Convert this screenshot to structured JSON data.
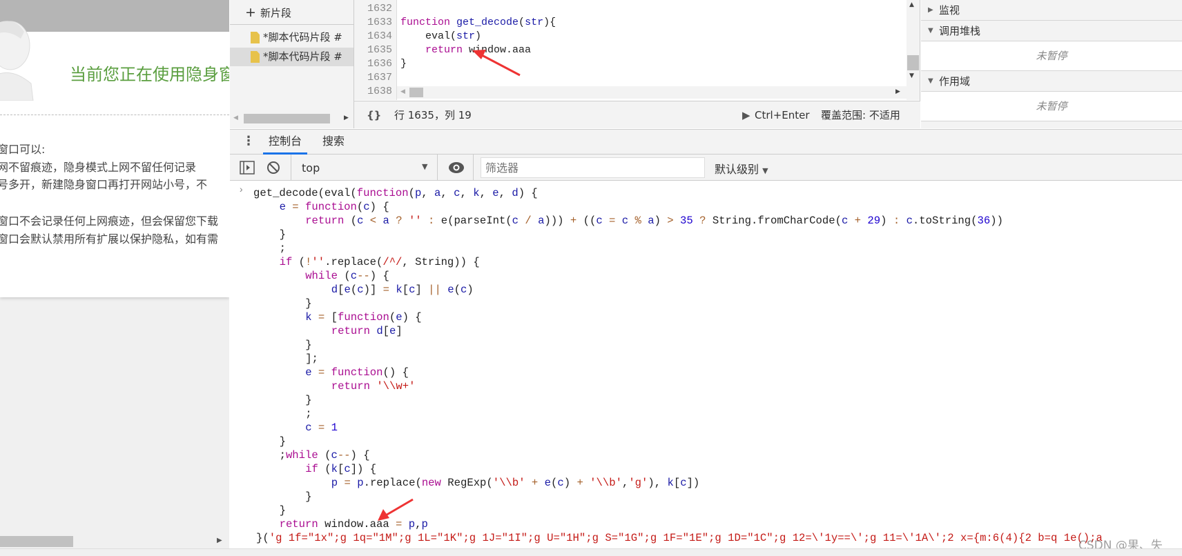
{
  "page": {
    "title": "当前您正在使用隐身窗",
    "lines": [
      "窗口可以:",
      "网不留痕迹，隐身模式上网不留任何记录",
      "号多开，新建隐身窗口再打开网站小号，不",
      "窗口不会记录任何上网痕迹，但会保留您下载",
      "窗口会默认禁用所有扩展以保护隐私，如有需"
    ]
  },
  "snippets": {
    "new_label": "新片段",
    "items": [
      {
        "label": "*脚本代码片段 #"
      },
      {
        "label": "*脚本代码片段 #",
        "selected": true
      }
    ]
  },
  "editor": {
    "lines": [
      {
        "num": "1632",
        "tokens": []
      },
      {
        "num": "1633",
        "tokens": [
          [
            "k",
            "function"
          ],
          [
            "t",
            " "
          ],
          [
            "v",
            "get_decode"
          ],
          [
            "t",
            "("
          ],
          [
            "v",
            "str"
          ],
          [
            "t",
            "){"
          ]
        ]
      },
      {
        "num": "1634",
        "tokens": [
          [
            "t",
            "    eval("
          ],
          [
            "v",
            "str"
          ],
          [
            "t",
            ")"
          ]
        ]
      },
      {
        "num": "1635",
        "tokens": [
          [
            "t",
            "    "
          ],
          [
            "k",
            "return"
          ],
          [
            "t",
            " window.aaa"
          ]
        ]
      },
      {
        "num": "1636",
        "tokens": [
          [
            "t",
            "}"
          ]
        ]
      },
      {
        "num": "1637",
        "tokens": []
      },
      {
        "num": "1638",
        "tokens": []
      }
    ],
    "status": {
      "format_icon": "{}",
      "position": "行 1635，列 19",
      "run_label": "Ctrl+Enter",
      "coverage": "覆盖范围: 不适用"
    }
  },
  "sidebar": {
    "sections": [
      {
        "label": "监视",
        "expanded": false
      },
      {
        "label": "调用堆栈",
        "expanded": true,
        "body": "未暂停"
      },
      {
        "label": "作用域",
        "expanded": true,
        "body": "未暂停"
      }
    ]
  },
  "console": {
    "tabs": [
      {
        "label": "控制台",
        "active": true
      },
      {
        "label": "搜索"
      }
    ],
    "context": "top",
    "filter_placeholder": "筛选器",
    "level": "默认级别",
    "lines": [
      {
        "i": 0,
        "p": true,
        "tokens": [
          [
            "t",
            "get_decode(eval("
          ],
          [
            "k",
            "function"
          ],
          [
            "t",
            "("
          ],
          [
            "v",
            "p"
          ],
          [
            "t",
            ", "
          ],
          [
            "v",
            "a"
          ],
          [
            "t",
            ", "
          ],
          [
            "v",
            "c"
          ],
          [
            "t",
            ", "
          ],
          [
            "v",
            "k"
          ],
          [
            "t",
            ", "
          ],
          [
            "v",
            "e"
          ],
          [
            "t",
            ", "
          ],
          [
            "v",
            "d"
          ],
          [
            "t",
            ") {"
          ]
        ]
      },
      {
        "i": 1,
        "tokens": [
          [
            "v",
            "e"
          ],
          [
            "o",
            " = "
          ],
          [
            "k",
            "function"
          ],
          [
            "t",
            "("
          ],
          [
            "v",
            "c"
          ],
          [
            "t",
            ") {"
          ]
        ]
      },
      {
        "i": 2,
        "tokens": [
          [
            "k",
            "return"
          ],
          [
            "t",
            " ("
          ],
          [
            "v",
            "c"
          ],
          [
            "o",
            " < "
          ],
          [
            "v",
            "a"
          ],
          [
            "o",
            " ? "
          ],
          [
            "s",
            "''"
          ],
          [
            "o",
            " : "
          ],
          [
            "t",
            "e(parseInt("
          ],
          [
            "v",
            "c"
          ],
          [
            "o",
            " / "
          ],
          [
            "v",
            "a"
          ],
          [
            "t",
            ")))"
          ],
          [
            "o",
            " + "
          ],
          [
            "t",
            "(("
          ],
          [
            "v",
            "c"
          ],
          [
            "o",
            " = "
          ],
          [
            "v",
            "c"
          ],
          [
            "o",
            " % "
          ],
          [
            "v",
            "a"
          ],
          [
            "t",
            ")"
          ],
          [
            "o",
            " > "
          ],
          [
            "n",
            "35"
          ],
          [
            "o",
            " ? "
          ],
          [
            "t",
            "String.fromCharCode("
          ],
          [
            "v",
            "c"
          ],
          [
            "o",
            " + "
          ],
          [
            "n",
            "29"
          ],
          [
            "t",
            ")"
          ],
          [
            "o",
            " : "
          ],
          [
            "v",
            "c"
          ],
          [
            "t",
            ".toString("
          ],
          [
            "n",
            "36"
          ],
          [
            "t",
            "))"
          ]
        ]
      },
      {
        "i": 1,
        "tokens": [
          [
            "t",
            "}"
          ]
        ]
      },
      {
        "i": 1,
        "tokens": [
          [
            "t",
            ";"
          ]
        ]
      },
      {
        "i": 1,
        "tokens": [
          [
            "k",
            "if"
          ],
          [
            "t",
            " ("
          ],
          [
            "o",
            "!"
          ],
          [
            "s",
            "''"
          ],
          [
            "t",
            ".replace("
          ],
          [
            "s",
            "/^/"
          ],
          [
            "t",
            ", String)) {"
          ]
        ]
      },
      {
        "i": 2,
        "tokens": [
          [
            "k",
            "while"
          ],
          [
            "t",
            " ("
          ],
          [
            "v",
            "c"
          ],
          [
            "o",
            "--"
          ],
          [
            "t",
            ") {"
          ]
        ]
      },
      {
        "i": 3,
        "tokens": [
          [
            "v",
            "d"
          ],
          [
            "t",
            "["
          ],
          [
            "v",
            "e"
          ],
          [
            "t",
            "("
          ],
          [
            "v",
            "c"
          ],
          [
            "t",
            ")]"
          ],
          [
            "o",
            " = "
          ],
          [
            "v",
            "k"
          ],
          [
            "t",
            "["
          ],
          [
            "v",
            "c"
          ],
          [
            "t",
            "]"
          ],
          [
            "o",
            " || "
          ],
          [
            "v",
            "e"
          ],
          [
            "t",
            "("
          ],
          [
            "v",
            "c"
          ],
          [
            "t",
            ")"
          ]
        ]
      },
      {
        "i": 2,
        "tokens": [
          [
            "t",
            "}"
          ]
        ]
      },
      {
        "i": 2,
        "tokens": [
          [
            "v",
            "k"
          ],
          [
            "o",
            " = "
          ],
          [
            "t",
            "["
          ],
          [
            "k",
            "function"
          ],
          [
            "t",
            "("
          ],
          [
            "v",
            "e"
          ],
          [
            "t",
            ") {"
          ]
        ]
      },
      {
        "i": 3,
        "tokens": [
          [
            "k",
            "return"
          ],
          [
            "t",
            " "
          ],
          [
            "v",
            "d"
          ],
          [
            "t",
            "["
          ],
          [
            "v",
            "e"
          ],
          [
            "t",
            "]"
          ]
        ]
      },
      {
        "i": 2,
        "tokens": [
          [
            "t",
            "}"
          ]
        ]
      },
      {
        "i": 2,
        "tokens": [
          [
            "t",
            "];"
          ]
        ]
      },
      {
        "i": 2,
        "tokens": [
          [
            "v",
            "e"
          ],
          [
            "o",
            " = "
          ],
          [
            "k",
            "function"
          ],
          [
            "t",
            "() {"
          ]
        ]
      },
      {
        "i": 3,
        "tokens": [
          [
            "k",
            "return"
          ],
          [
            "t",
            " "
          ],
          [
            "s",
            "'\\\\w+'"
          ]
        ]
      },
      {
        "i": 2,
        "tokens": [
          [
            "t",
            "}"
          ]
        ]
      },
      {
        "i": 2,
        "tokens": [
          [
            "t",
            ";"
          ]
        ]
      },
      {
        "i": 2,
        "tokens": [
          [
            "v",
            "c"
          ],
          [
            "o",
            " = "
          ],
          [
            "n",
            "1"
          ]
        ]
      },
      {
        "i": 1,
        "tokens": [
          [
            "t",
            "}"
          ]
        ]
      },
      {
        "i": 1,
        "tokens": [
          [
            "t",
            ";"
          ],
          [
            "k",
            "while"
          ],
          [
            "t",
            " ("
          ],
          [
            "v",
            "c"
          ],
          [
            "o",
            "--"
          ],
          [
            "t",
            ") {"
          ]
        ]
      },
      {
        "i": 2,
        "tokens": [
          [
            "k",
            "if"
          ],
          [
            "t",
            " ("
          ],
          [
            "v",
            "k"
          ],
          [
            "t",
            "["
          ],
          [
            "v",
            "c"
          ],
          [
            "t",
            "]) {"
          ]
        ]
      },
      {
        "i": 3,
        "tokens": [
          [
            "v",
            "p"
          ],
          [
            "o",
            " = "
          ],
          [
            "v",
            "p"
          ],
          [
            "t",
            ".replace("
          ],
          [
            "k",
            "new"
          ],
          [
            "t",
            " RegExp("
          ],
          [
            "s",
            "'\\\\b'"
          ],
          [
            "o",
            " + "
          ],
          [
            "v",
            "e"
          ],
          [
            "t",
            "("
          ],
          [
            "v",
            "c"
          ],
          [
            "t",
            ")"
          ],
          [
            "o",
            " + "
          ],
          [
            "s",
            "'\\\\b'"
          ],
          [
            "t",
            ","
          ],
          [
            "s",
            "'g'"
          ],
          [
            "t",
            "), "
          ],
          [
            "v",
            "k"
          ],
          [
            "t",
            "["
          ],
          [
            "v",
            "c"
          ],
          [
            "t",
            "])"
          ]
        ]
      },
      {
        "i": 2,
        "tokens": [
          [
            "t",
            "}"
          ]
        ]
      },
      {
        "i": 1,
        "tokens": [
          [
            "t",
            "}"
          ]
        ]
      },
      {
        "i": 1,
        "tokens": [
          [
            "k",
            "return"
          ],
          [
            "t",
            " window.aaa"
          ],
          [
            "o",
            " = "
          ],
          [
            "v",
            "p"
          ],
          [
            "t",
            ","
          ],
          [
            "v",
            "p"
          ]
        ]
      },
      {
        "i": 0,
        "tokens": [
          [
            "t",
            "}("
          ],
          [
            "s",
            "'g 1f=\"1x\";g 1q=\"1M\";g 1L=\"1K\";g 1J=\"1I\";g U=\"1H\";g S=\"1G\";g 1F=\"1E\";g 1D=\"1C\";g 12=\\'1y==\\';g 11=\\'1A\\';2 x={m:6(4){2 b=q 1e();a"
          ]
        ]
      }
    ]
  },
  "watermark": "CSDN @果、失",
  "colors": {
    "accent": "#1a73e8",
    "arrow": "#ee3333",
    "title_green": "#5a9e3f"
  }
}
